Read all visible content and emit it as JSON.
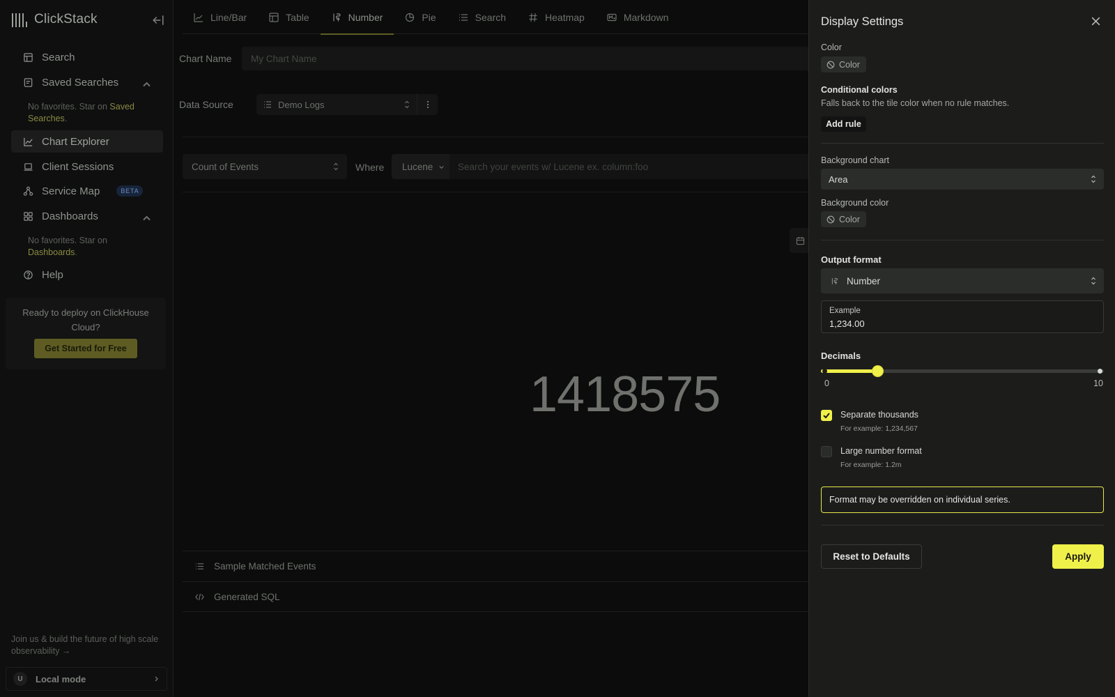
{
  "sidebar": {
    "brand": "ClickStack",
    "items": [
      {
        "label": "Search"
      },
      {
        "label": "Saved Searches"
      },
      {
        "label": "Chart Explorer"
      },
      {
        "label": "Client Sessions"
      },
      {
        "label": "Service Map",
        "badge": "BETA"
      },
      {
        "label": "Dashboards"
      },
      {
        "label": "Help"
      }
    ],
    "saved_note_prefix": "No favorites. Star on ",
    "saved_note_link": "Saved Searches",
    "dash_note_prefix": "No favorites. Star on ",
    "dash_note_link": "Dashboards",
    "period": ".",
    "promo_text": "Ready to deploy on ClickHouse Cloud?",
    "promo_button": "Get Started for Free",
    "join_text": "Join us & build the future of high scale observability →",
    "user_initial": "U",
    "user_mode": "Local mode"
  },
  "tabs": [
    {
      "label": "Line/Bar",
      "icon": "line-chart-icon"
    },
    {
      "label": "Table",
      "icon": "table-icon"
    },
    {
      "label": "Number",
      "icon": "number-icon"
    },
    {
      "label": "Pie",
      "icon": "pie-icon"
    },
    {
      "label": "Search",
      "icon": "list-icon"
    },
    {
      "label": "Heatmap",
      "icon": "hash-icon"
    },
    {
      "label": "Markdown",
      "icon": "markdown-icon"
    }
  ],
  "active_tab": "Number",
  "editor": {
    "chart_name_label": "Chart Name",
    "chart_name_placeholder": "My Chart Name",
    "data_source_label": "Data Source",
    "data_source_value": "Demo Logs",
    "aggregation_value": "Count of Events",
    "where_label": "Where",
    "query_language": "Lucene",
    "search_placeholder": "Search your events w/ Lucene ex. column:foo",
    "result_value": "1418575",
    "sample_events_label": "Sample Matched Events",
    "generated_sql_label": "Generated SQL"
  },
  "drawer": {
    "title": "Display Settings",
    "color_label": "Color",
    "color_chip": "Color",
    "conditional_title": "Conditional colors",
    "conditional_help": "Falls back to the tile color when no rule matches.",
    "add_rule": "Add rule",
    "bg_chart_label": "Background chart",
    "bg_chart_value": "Area",
    "bg_color_label": "Background color",
    "bg_color_chip": "Color",
    "output_format_title": "Output format",
    "output_format_value": "Number",
    "example_label": "Example",
    "example_value": "1,234.00",
    "decimals_title": "Decimals",
    "decimals_min": "0",
    "decimals_max": "10",
    "decimals_value": 2,
    "separate_thousands_label": "Separate thousands",
    "separate_thousands_help": "For example: 1,234,567",
    "separate_thousands_checked": true,
    "large_number_label": "Large number format",
    "large_number_help": "For example: 1.2m",
    "large_number_checked": false,
    "notice": "Format may be overridden on individual series.",
    "reset_button": "Reset to Defaults",
    "apply_button": "Apply",
    "accent_color": "#f0f04a"
  }
}
